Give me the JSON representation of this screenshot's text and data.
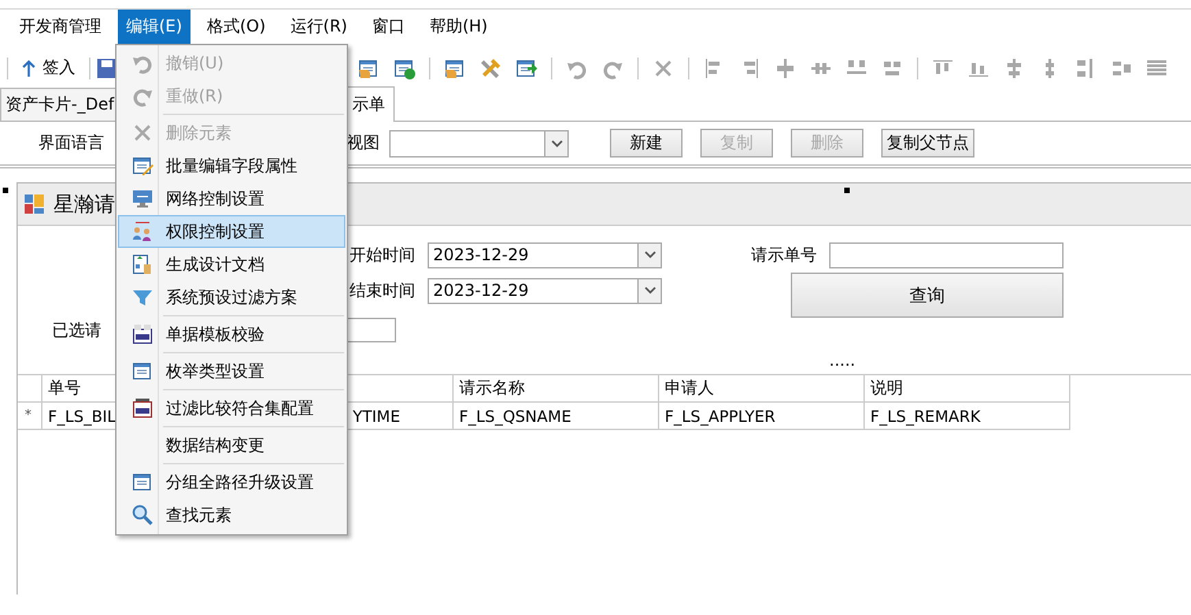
{
  "menubar": [
    {
      "label": "开发商管理",
      "selected": false
    },
    {
      "label": "编辑(E)",
      "selected": true
    },
    {
      "label": "格式(O)",
      "selected": false
    },
    {
      "label": "运行(R)",
      "selected": false
    },
    {
      "label": "窗口",
      "selected": false
    },
    {
      "label": "帮助(H)",
      "selected": false
    }
  ],
  "toolbar": {
    "checkin_button": "签入"
  },
  "tabs": [
    {
      "label": "资产卡片-_Def",
      "selected": false
    },
    {
      "label": "示单",
      "selected": true
    }
  ],
  "designer_bar": {
    "language_label": "界面语言",
    "view_label": "视图",
    "buttons": [
      {
        "label": "新建",
        "disabled": false
      },
      {
        "label": "复制",
        "disabled": true
      },
      {
        "label": "删除",
        "disabled": true
      },
      {
        "label": "复制父节点",
        "disabled": false
      }
    ]
  },
  "form_panel": {
    "title": "星瀚请",
    "start_label": "开始时间",
    "start_value": "2023-12-29",
    "end_label": "结束时间",
    "end_value": "2023-12-29",
    "bill_no_label": "请示单号",
    "query_button": "查询",
    "selected_label": "已选请",
    "more_marker": "....."
  },
  "table": {
    "new_row_marker": "*",
    "columns": [
      "单号",
      null,
      "请示名称",
      "申请人",
      "说明"
    ],
    "rows": [
      [
        "F_LS_BIL",
        "YTIME",
        "F_LS_QSNAME",
        "F_LS_APPLYER",
        "F_LS_REMARK"
      ]
    ]
  },
  "edit_menu": [
    {
      "label": "撤销(U)",
      "disabled": true,
      "selected": false,
      "separator": false
    },
    {
      "label": "重做(R)",
      "disabled": true,
      "selected": false,
      "separator": false
    },
    {
      "label": "删除元素",
      "disabled": true,
      "selected": false,
      "separator": true
    },
    {
      "label": "批量编辑字段属性",
      "disabled": false,
      "selected": false,
      "separator": false
    },
    {
      "label": "网络控制设置",
      "disabled": false,
      "selected": false,
      "separator": false
    },
    {
      "label": "权限控制设置",
      "disabled": false,
      "selected": true,
      "separator": false
    },
    {
      "label": "生成设计文档",
      "disabled": false,
      "selected": false,
      "separator": false
    },
    {
      "label": "系统预设过滤方案",
      "disabled": false,
      "selected": false,
      "separator": false
    },
    {
      "label": "单据模板校验",
      "disabled": false,
      "selected": false,
      "separator": true
    },
    {
      "label": "枚举类型设置",
      "disabled": false,
      "selected": false,
      "separator": true
    },
    {
      "label": "过滤比较符合集配置",
      "disabled": false,
      "selected": false,
      "separator": true
    },
    {
      "label": "数据结构变更",
      "disabled": false,
      "selected": false,
      "separator": true
    },
    {
      "label": "分组全路径升级设置",
      "disabled": false,
      "selected": false,
      "separator": true
    },
    {
      "label": "查找元素",
      "disabled": false,
      "selected": false,
      "separator": false
    }
  ]
}
